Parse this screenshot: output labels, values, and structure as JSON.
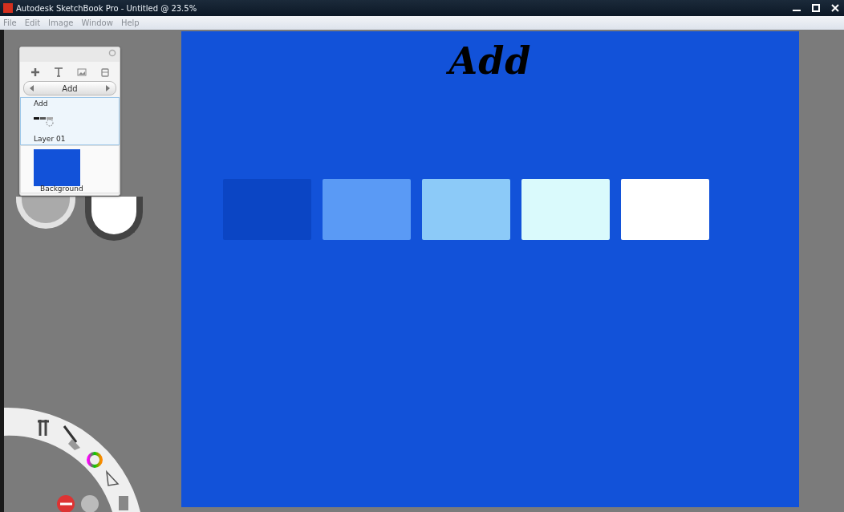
{
  "window": {
    "title": "Autodesk SketchBook Pro - Untitled @ 23.5%"
  },
  "menu": [
    "File",
    "Edit",
    "Image",
    "Window",
    "Help"
  ],
  "canvas": {
    "heading": "Add",
    "swatches": [
      {
        "color": "#0b45c4"
      },
      {
        "color": "#5a9af5"
      },
      {
        "color": "#8ccaf8"
      },
      {
        "color": "#dafafc"
      },
      {
        "color": "#ffffff"
      }
    ]
  },
  "layers_panel": {
    "blend_mode": "Add",
    "layers": [
      {
        "name": "Layer 01",
        "blend": "Add",
        "selected": true,
        "kind": "strokes"
      },
      {
        "name": "Background",
        "selected": false,
        "kind": "fill",
        "color": "#1252d9"
      }
    ]
  }
}
